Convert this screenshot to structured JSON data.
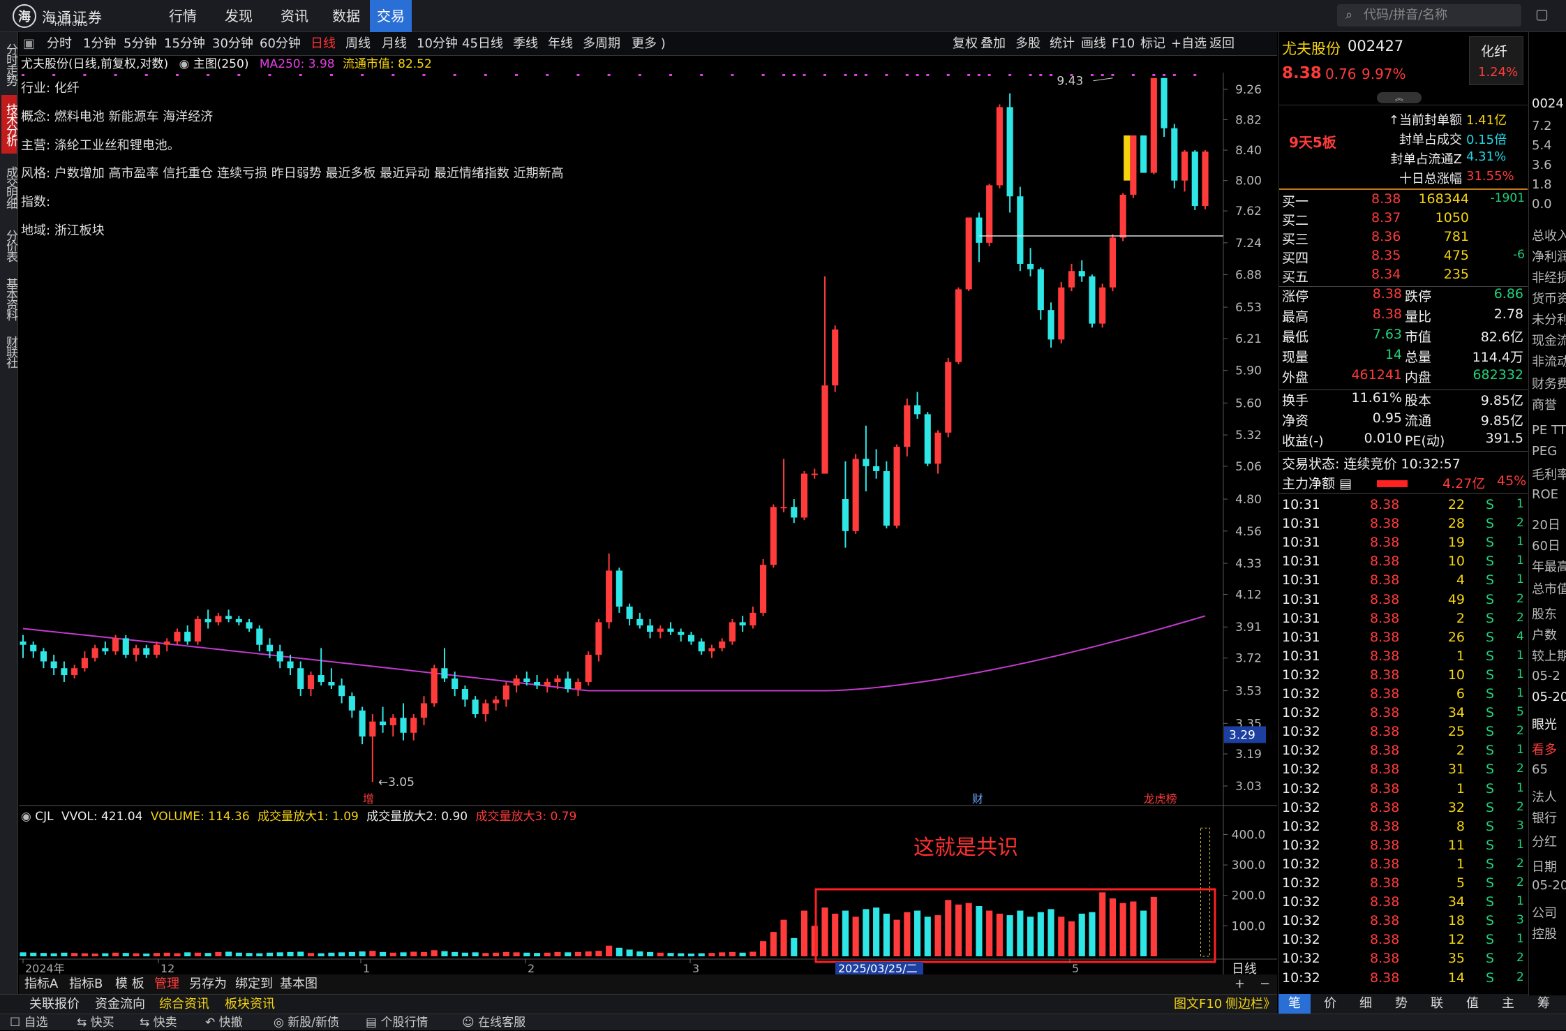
{
  "app": {
    "logo_text": "海通证券",
    "logo_sub": "HAITONG",
    "nav": [
      "行情",
      "发现",
      "资讯",
      "数据",
      "交易"
    ],
    "active_nav": "交易",
    "search_placeholder": "代码/拼音/名称"
  },
  "left_tabs": [
    "分时走势",
    "技术分析",
    "成交明细",
    "分价表",
    "基本资料",
    "财联社"
  ],
  "period_bar": {
    "items": [
      "分时",
      "1分钟",
      "5分钟",
      "15分钟",
      "30分钟",
      "60分钟",
      "日线",
      "周线",
      "月线",
      "10分钟",
      "45日线",
      "季线",
      "年线",
      "多周期",
      "更多 )"
    ],
    "active": "日线",
    "tools": [
      "复权",
      "叠加",
      "多股",
      "统计",
      "画线",
      "F10",
      "标记",
      "+自选",
      "返回"
    ]
  },
  "chart_header": {
    "title": "尤夫股份(日线,前复权,对数)",
    "main": "主图(250)",
    "ma": "MA250: 3.98",
    "float_mv": "流通市值: 82.52"
  },
  "info": {
    "industry_k": "行业:",
    "industry": "化纤",
    "concept_k": "概念:",
    "concept": "燃料电池 新能源车 海洋经济",
    "business_k": "主营:",
    "business": "涤纶工业丝和锂电池。",
    "style_k": "风格:",
    "style": "户数增加 高市盈率 信托重仓 连续亏损 昨日弱势 最近多板 最近异动 最近情绪指数 近期新高",
    "index_k": "指数:",
    "index": "",
    "region_k": "地域:",
    "region": "浙江板块"
  },
  "price_axis": [
    "9.26",
    "8.82",
    "8.40",
    "8.00",
    "7.62",
    "7.24",
    "6.88",
    "6.53",
    "6.21",
    "5.90",
    "5.60",
    "5.32",
    "5.06",
    "4.80",
    "4.56",
    "4.33",
    "4.12",
    "3.91",
    "3.72",
    "3.53",
    "3.35",
    "3.19",
    "3.03"
  ],
  "price_marker": "3.29",
  "high_label": "9.43",
  "low_label": "3.05",
  "bottom_marks": {
    "zeng": "增",
    "cai": "财",
    "longhu": "龙虎榜"
  },
  "vol_header": {
    "cjl": "CJL",
    "vvol": "VVOL: 421.04",
    "volume": "VOLUME: 114.36",
    "f1": "成交量放大1: 1.09",
    "f2": "成交量放大2: 0.90",
    "f3": "成交量放大3: 0.79"
  },
  "vol_axis": [
    "400.0",
    "300.0",
    "200.0",
    "100.0"
  ],
  "annotation": "这就是共识",
  "date_axis": [
    "2024年",
    "12",
    "1",
    "2",
    "3",
    "2025/03/25/二",
    "5"
  ],
  "period_label": "日线",
  "bottom1": [
    "指标A",
    "指标B",
    "模 板",
    "管理",
    "另存为",
    "绑定到",
    "基本图"
  ],
  "bottom1_active": "管理",
  "bottom2": [
    "关联报价",
    "资金流向",
    "综合资讯",
    "板块资讯"
  ],
  "bottom2_right": [
    "图文F10",
    "侧边栏》"
  ],
  "bottom3": [
    "自选",
    "快买",
    "快卖",
    "快撤",
    "新股/新债",
    "个股行情",
    "在线客服"
  ],
  "stock": {
    "name": "尤夫股份",
    "code": "002427",
    "price": "8.38",
    "change": "0.76",
    "pct": "9.97%",
    "industry": "化纤",
    "ind_pct": "1.24%",
    "board": "9天5板",
    "seal": [
      [
        "当前封单额",
        "1.41亿"
      ],
      [
        "封单占成交",
        "0.15倍"
      ],
      [
        "封单占流通Z",
        "4.31%"
      ],
      [
        "十日总涨幅",
        "31.55%"
      ]
    ],
    "bids": [
      [
        "买一",
        "8.38",
        "168344",
        "-1901"
      ],
      [
        "买二",
        "8.37",
        "1050",
        ""
      ],
      [
        "买三",
        "8.36",
        "781",
        ""
      ],
      [
        "买四",
        "8.35",
        "475",
        "-6"
      ],
      [
        "买五",
        "8.34",
        "235",
        ""
      ]
    ],
    "stats": [
      [
        "涨停",
        "8.38",
        "跌停",
        "6.86"
      ],
      [
        "最高",
        "8.38",
        "量比",
        "2.78"
      ],
      [
        "最低",
        "7.63",
        "市值",
        "82.6亿"
      ],
      [
        "现量",
        "14",
        "总量",
        "114.4万"
      ],
      [
        "外盘",
        "461241",
        "内盘",
        "682332"
      ],
      [
        "换手",
        "11.61%",
        "股本",
        "9.85亿"
      ],
      [
        "净资",
        "0.95",
        "流通",
        "9.85亿"
      ],
      [
        "收益(-)",
        "0.010",
        "PE(动)",
        "391.5"
      ]
    ],
    "trade_state": "交易状态: 连续竞价 10:32:57",
    "net_k": "主力净额",
    "net": "4.27亿",
    "net_pct": "45%",
    "ticks": [
      [
        "10:31",
        "8.38",
        "22",
        "S"
      ],
      [
        "10:31",
        "8.38",
        "28",
        "S"
      ],
      [
        "10:31",
        "8.38",
        "19",
        "S"
      ],
      [
        "10:31",
        "8.38",
        "10",
        "S"
      ],
      [
        "10:31",
        "8.38",
        "4",
        "S"
      ],
      [
        "10:31",
        "8.38",
        "49",
        "S"
      ],
      [
        "10:31",
        "8.38",
        "2",
        "S"
      ],
      [
        "10:31",
        "8.38",
        "26",
        "S"
      ],
      [
        "10:31",
        "8.38",
        "1",
        "S"
      ],
      [
        "10:32",
        "8.38",
        "10",
        "S"
      ],
      [
        "10:32",
        "8.38",
        "6",
        "S"
      ],
      [
        "10:32",
        "8.38",
        "34",
        "S"
      ],
      [
        "10:32",
        "8.38",
        "25",
        "S"
      ],
      [
        "10:32",
        "8.38",
        "2",
        "S"
      ],
      [
        "10:32",
        "8.38",
        "31",
        "S"
      ],
      [
        "10:32",
        "8.38",
        "1",
        "S"
      ],
      [
        "10:32",
        "8.38",
        "32",
        "S"
      ],
      [
        "10:32",
        "8.38",
        "8",
        "S"
      ],
      [
        "10:32",
        "8.38",
        "11",
        "S"
      ],
      [
        "10:32",
        "8.38",
        "1",
        "S"
      ],
      [
        "10:32",
        "8.38",
        "5",
        "S"
      ],
      [
        "10:32",
        "8.38",
        "34",
        "S"
      ],
      [
        "10:32",
        "8.38",
        "18",
        "S"
      ],
      [
        "10:32",
        "8.38",
        "12",
        "S"
      ],
      [
        "10:32",
        "8.38",
        "35",
        "S"
      ],
      [
        "10:32",
        "8.38",
        "14",
        "S"
      ]
    ],
    "tick_tail": [
      "1",
      "2",
      "1",
      "1",
      "1",
      "2",
      "2",
      "4",
      "1",
      "1",
      "1",
      "5",
      "2",
      "1",
      "2",
      "1",
      "2",
      "3",
      "1",
      "2",
      "2",
      "1",
      "3",
      "1",
      "2",
      "2"
    ]
  },
  "right_bottom": [
    "笔",
    "价",
    "细",
    "势",
    "联",
    "值",
    "主",
    "筹"
  ],
  "far_right": [
    "0024",
    "7.2",
    "5.4",
    "3.6",
    "1.8",
    "0.0",
    "总收入",
    "净利润",
    "非经损",
    "货币资",
    "未分利",
    "现金流",
    "非流动",
    "财务费",
    "商誉",
    "PE TTM",
    "PEG",
    "毛利率",
    "ROE",
    "20日",
    "60日",
    "年最高",
    "总市值",
    "股东",
    "户数",
    "较上期",
    "05-2",
    "05-20",
    "眼光",
    "看多",
    "65",
    "法人",
    "银行",
    "分红",
    "日期",
    "05-20",
    "公司",
    "控股"
  ],
  "colors": {
    "up": "#ff3b3b",
    "down": "#2ee6e6",
    "ma": "#c53ad1",
    "active_blue": "#2a6fd6"
  },
  "chart_data": {
    "type": "candlestick",
    "ma250_label": "MA250",
    "ohlc": [
      [
        3.82,
        3.86,
        3.72,
        3.8
      ],
      [
        3.8,
        3.82,
        3.72,
        3.76
      ],
      [
        3.76,
        3.78,
        3.66,
        3.7
      ],
      [
        3.7,
        3.74,
        3.62,
        3.66
      ],
      [
        3.66,
        3.7,
        3.58,
        3.62
      ],
      [
        3.62,
        3.68,
        3.6,
        3.66
      ],
      [
        3.66,
        3.76,
        3.64,
        3.72
      ],
      [
        3.72,
        3.8,
        3.7,
        3.78
      ],
      [
        3.78,
        3.82,
        3.74,
        3.76
      ],
      [
        3.76,
        3.86,
        3.74,
        3.84
      ],
      [
        3.84,
        3.86,
        3.72,
        3.74
      ],
      [
        3.74,
        3.8,
        3.7,
        3.78
      ],
      [
        3.78,
        3.8,
        3.72,
        3.74
      ],
      [
        3.74,
        3.82,
        3.72,
        3.8
      ],
      [
        3.8,
        3.84,
        3.76,
        3.82
      ],
      [
        3.82,
        3.9,
        3.8,
        3.88
      ],
      [
        3.88,
        3.92,
        3.8,
        3.82
      ],
      [
        3.82,
        3.98,
        3.8,
        3.96
      ],
      [
        3.96,
        4.02,
        3.9,
        3.94
      ],
      [
        3.94,
        4.0,
        3.92,
        3.98
      ],
      [
        3.98,
        4.02,
        3.94,
        3.96
      ],
      [
        3.96,
        3.98,
        3.92,
        3.94
      ],
      [
        3.94,
        3.96,
        3.88,
        3.9
      ],
      [
        3.9,
        3.92,
        3.76,
        3.8
      ],
      [
        3.8,
        3.84,
        3.72,
        3.76
      ],
      [
        3.76,
        3.8,
        3.66,
        3.7
      ],
      [
        3.7,
        3.74,
        3.62,
        3.66
      ],
      [
        3.66,
        3.7,
        3.5,
        3.54
      ],
      [
        3.54,
        3.64,
        3.5,
        3.62
      ],
      [
        3.62,
        3.78,
        3.56,
        3.58
      ],
      [
        3.58,
        3.66,
        3.54,
        3.56
      ],
      [
        3.56,
        3.6,
        3.46,
        3.5
      ],
      [
        3.5,
        3.52,
        3.38,
        3.42
      ],
      [
        3.42,
        3.44,
        3.24,
        3.28
      ],
      [
        3.28,
        3.4,
        3.05,
        3.36
      ],
      [
        3.36,
        3.44,
        3.3,
        3.34
      ],
      [
        3.34,
        3.4,
        3.28,
        3.38
      ],
      [
        3.38,
        3.46,
        3.26,
        3.3
      ],
      [
        3.3,
        3.4,
        3.26,
        3.38
      ],
      [
        3.38,
        3.5,
        3.34,
        3.46
      ],
      [
        3.46,
        3.68,
        3.44,
        3.66
      ],
      [
        3.66,
        3.78,
        3.58,
        3.6
      ],
      [
        3.6,
        3.64,
        3.5,
        3.54
      ],
      [
        3.54,
        3.56,
        3.44,
        3.48
      ],
      [
        3.48,
        3.5,
        3.38,
        3.4
      ],
      [
        3.4,
        3.48,
        3.36,
        3.46
      ],
      [
        3.46,
        3.5,
        3.42,
        3.48
      ],
      [
        3.48,
        3.58,
        3.44,
        3.56
      ],
      [
        3.56,
        3.62,
        3.52,
        3.6
      ],
      [
        3.6,
        3.64,
        3.56,
        3.58
      ],
      [
        3.58,
        3.62,
        3.54,
        3.56
      ],
      [
        3.56,
        3.6,
        3.52,
        3.58
      ],
      [
        3.58,
        3.62,
        3.54,
        3.6
      ],
      [
        3.6,
        3.64,
        3.52,
        3.54
      ],
      [
        3.54,
        3.6,
        3.5,
        3.58
      ],
      [
        3.58,
        3.76,
        3.56,
        3.74
      ],
      [
        3.74,
        3.96,
        3.7,
        3.94
      ],
      [
        3.94,
        4.4,
        3.9,
        4.28
      ],
      [
        4.28,
        4.3,
        4.0,
        4.04
      ],
      [
        4.04,
        4.06,
        3.92,
        3.96
      ],
      [
        3.96,
        4.0,
        3.9,
        3.92
      ],
      [
        3.92,
        3.96,
        3.84,
        3.88
      ],
      [
        3.88,
        3.92,
        3.84,
        3.9
      ],
      [
        3.9,
        3.94,
        3.86,
        3.88
      ],
      [
        3.88,
        3.9,
        3.82,
        3.86
      ],
      [
        3.86,
        3.88,
        3.8,
        3.82
      ],
      [
        3.82,
        3.84,
        3.74,
        3.76
      ],
      [
        3.76,
        3.8,
        3.72,
        3.78
      ],
      [
        3.78,
        3.84,
        3.76,
        3.82
      ],
      [
        3.82,
        3.96,
        3.8,
        3.94
      ],
      [
        3.94,
        3.98,
        3.88,
        3.92
      ],
      [
        3.92,
        4.04,
        3.9,
        4.0
      ],
      [
        4.0,
        4.36,
        3.98,
        4.32
      ],
      [
        4.32,
        4.76,
        4.3,
        4.74
      ],
      [
        4.74,
        5.12,
        4.7,
        4.74
      ],
      [
        4.74,
        4.8,
        4.62,
        4.66
      ],
      [
        4.66,
        5.02,
        4.64,
        5.0
      ],
      [
        5.0,
        5.04,
        4.96,
        5.0
      ],
      [
        5.0,
        6.86,
        5.76,
        5.76
      ],
      [
        5.76,
        6.34,
        5.7,
        6.3
      ],
      [
        4.8,
        5.1,
        4.44,
        4.56
      ],
      [
        4.56,
        5.16,
        4.54,
        5.12
      ],
      [
        5.12,
        5.4,
        4.86,
        5.06
      ],
      [
        5.06,
        5.2,
        4.96,
        5.02
      ],
      [
        5.02,
        5.1,
        4.58,
        4.6
      ],
      [
        4.6,
        5.24,
        4.58,
        5.22
      ],
      [
        5.22,
        5.64,
        5.14,
        5.58
      ],
      [
        5.58,
        5.7,
        5.46,
        5.5
      ],
      [
        5.5,
        5.52,
        5.06,
        5.08
      ],
      [
        5.08,
        5.36,
        5.0,
        5.34
      ],
      [
        5.34,
        6.02,
        5.3,
        5.98
      ],
      [
        5.98,
        6.74,
        5.96,
        6.72
      ],
      [
        6.72,
        7.54,
        6.7,
        7.54
      ],
      [
        7.54,
        7.6,
        7.02,
        7.24
      ],
      [
        7.24,
        7.96,
        7.2,
        7.94
      ],
      [
        7.94,
        9.04,
        7.9,
        9.0
      ],
      [
        9.0,
        9.2,
        7.6,
        7.8
      ],
      [
        7.8,
        7.92,
        6.92,
        7.0
      ],
      [
        7.0,
        7.18,
        6.86,
        6.94
      ],
      [
        6.94,
        6.96,
        6.4,
        6.5
      ],
      [
        6.5,
        6.58,
        6.12,
        6.2
      ],
      [
        6.2,
        6.8,
        6.16,
        6.74
      ],
      [
        6.74,
        7.0,
        6.7,
        6.92
      ],
      [
        6.92,
        7.04,
        6.8,
        6.86
      ],
      [
        6.86,
        6.88,
        6.32,
        6.36
      ],
      [
        6.36,
        6.78,
        6.32,
        6.74
      ],
      [
        6.74,
        7.34,
        6.7,
        7.3
      ],
      [
        7.3,
        7.84,
        7.26,
        7.82
      ],
      [
        7.82,
        8.6,
        7.78,
        8.6
      ],
      [
        8.6,
        8.6,
        8.1,
        8.1
      ],
      [
        8.1,
        9.43,
        8.08,
        9.43
      ],
      [
        9.43,
        9.43,
        8.58,
        8.7
      ],
      [
        8.7,
        8.76,
        7.9,
        8.0
      ],
      [
        8.0,
        8.4,
        7.86,
        8.38
      ],
      [
        8.38,
        8.4,
        7.63,
        7.68
      ],
      [
        7.68,
        8.4,
        7.64,
        8.38
      ]
    ],
    "volume": [
      13,
      12,
      11,
      10,
      12,
      11,
      10,
      9,
      10,
      12,
      11,
      10,
      9,
      11,
      12,
      10,
      13,
      12,
      11,
      14,
      15,
      12,
      11,
      10,
      12,
      13,
      14,
      15,
      11,
      10,
      12,
      13,
      14,
      16,
      18,
      14,
      12,
      13,
      15,
      14,
      20,
      17,
      14,
      12,
      13,
      11,
      12,
      14,
      13,
      12,
      11,
      12,
      14,
      13,
      14,
      16,
      18,
      35,
      28,
      22,
      16,
      14,
      12,
      11,
      10,
      9,
      10,
      11,
      13,
      14,
      12,
      15,
      50,
      80,
      120,
      60,
      150,
      100,
      160,
      140,
      150,
      130,
      155,
      160,
      140,
      120,
      145,
      150,
      130,
      135,
      185,
      170,
      175,
      165,
      150,
      140,
      135,
      150,
      130,
      145,
      155,
      130,
      115,
      140,
      145,
      210,
      190,
      175,
      180,
      150,
      195
    ]
  }
}
